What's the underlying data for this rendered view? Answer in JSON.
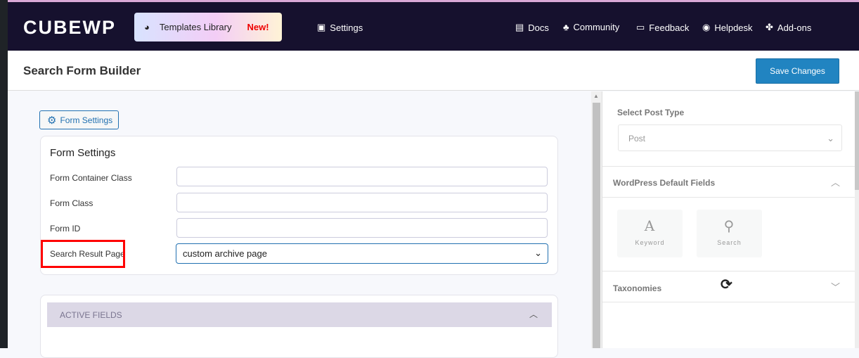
{
  "header": {
    "logo": "CUBEWP",
    "templates_library": "Templates Library",
    "new_badge": "New!",
    "settings": "Settings",
    "docs": "Docs",
    "community": "Community",
    "feedback": "Feedback",
    "helpdesk": "Helpdesk",
    "addons": "Add-ons"
  },
  "page": {
    "title": "Search Form Builder",
    "save_label": "Save Changes"
  },
  "form": {
    "settings_button": "Form Settings",
    "heading": "Form Settings",
    "fields": [
      {
        "label": "Form Container Class",
        "value": ""
      },
      {
        "label": "Form Class",
        "value": ""
      },
      {
        "label": "Form ID",
        "value": ""
      }
    ],
    "result_page_label": "Search Result Page",
    "result_page_value": "custom archive page"
  },
  "active_fields": "ACTIVE FIELDS",
  "sidebar": {
    "post_type_label": "Select Post Type",
    "post_type_value": "Post",
    "default_fields": "WordPress Default Fields",
    "tiles": [
      "Keyword",
      "Search"
    ],
    "taxonomies": "Taxonomies"
  },
  "colors": {
    "header": "#16112e",
    "accent": "#2184c1",
    "highlight": "#ff0000"
  }
}
